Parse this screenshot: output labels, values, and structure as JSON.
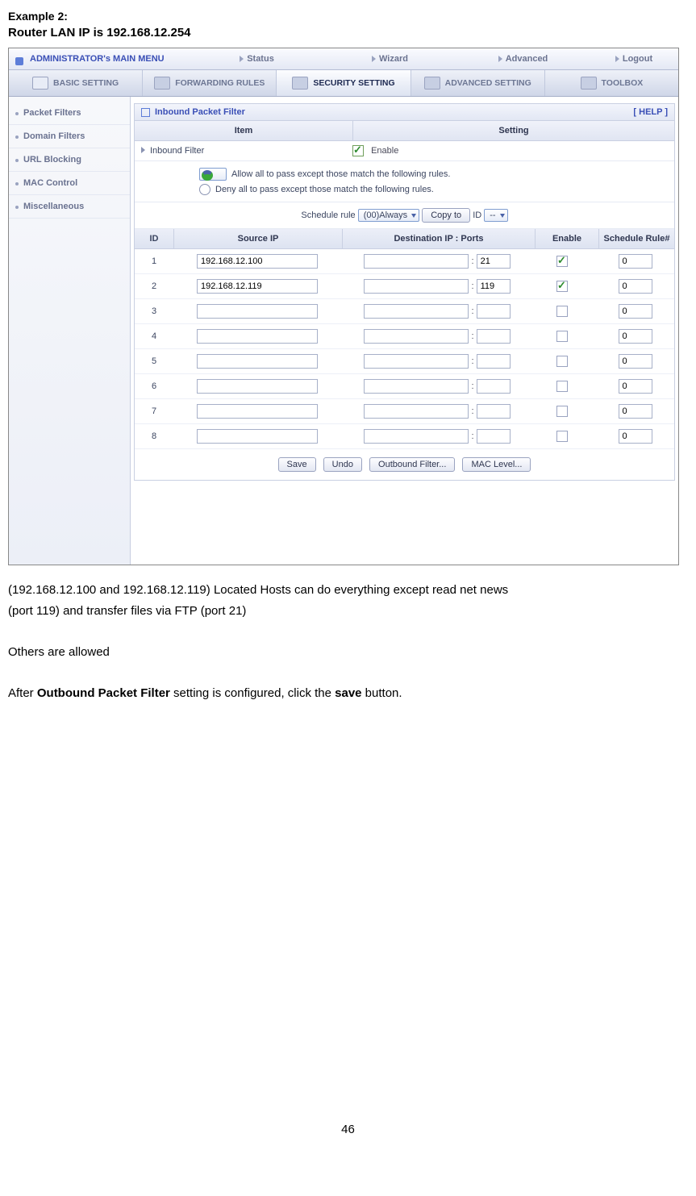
{
  "doc": {
    "example_label": "Example 2:",
    "router_line": "Router LAN IP is 192.168.12.254",
    "para1_a": "(192.168.12.100 and 192.168.12.119) Located Hosts can do everything except read net news",
    "para1_b": "(port 119) and transfer files via FTP (port 21)",
    "para2": "Others are allowed",
    "para3_a": "After ",
    "para3_bold": "Outbound Packet Filter",
    "para3_b": " setting is configured, click the ",
    "para3_bold2": "save",
    "para3_c": " button.",
    "pagenum": "46"
  },
  "topbar": {
    "title": "ADMINISTRATOR's MAIN MENU",
    "items": [
      "Status",
      "Wizard",
      "Advanced"
    ],
    "logout": "Logout"
  },
  "tabs": [
    "BASIC SETTING",
    "FORWARDING RULES",
    "SECURITY SETTING",
    "ADVANCED SETTING",
    "TOOLBOX"
  ],
  "tabs_active_index": 2,
  "sidebar": [
    "Packet Filters",
    "Domain Filters",
    "URL Blocking",
    "MAC Control",
    "Miscellaneous"
  ],
  "panel": {
    "title": "Inbound Packet Filter",
    "help": "[ HELP ]",
    "col_item": "Item",
    "col_setting": "Setting",
    "inbound_label": "Inbound Filter",
    "enable_label": "Enable",
    "radio_allow": "Allow all to pass except those match the following rules.",
    "radio_deny": "Deny all to pass except those match the following rules.",
    "sched_label": "Schedule rule",
    "sched_sel": "(00)Always",
    "copy_btn": "Copy to",
    "id_label": "ID",
    "id_sel": "--"
  },
  "grid": {
    "headers": {
      "id": "ID",
      "src": "Source IP",
      "dst": "Destination IP : Ports",
      "en": "Enable",
      "sch": "Schedule Rule#"
    },
    "rows": [
      {
        "id": "1",
        "src": "192.168.12.100",
        "dst_ip": "",
        "dst_port": "21",
        "en": true,
        "sch": "0"
      },
      {
        "id": "2",
        "src": "192.168.12.119",
        "dst_ip": "",
        "dst_port": "119",
        "en": true,
        "sch": "0"
      },
      {
        "id": "3",
        "src": "",
        "dst_ip": "",
        "dst_port": "",
        "en": false,
        "sch": "0"
      },
      {
        "id": "4",
        "src": "",
        "dst_ip": "",
        "dst_port": "",
        "en": false,
        "sch": "0"
      },
      {
        "id": "5",
        "src": "",
        "dst_ip": "",
        "dst_port": "",
        "en": false,
        "sch": "0"
      },
      {
        "id": "6",
        "src": "",
        "dst_ip": "",
        "dst_port": "",
        "en": false,
        "sch": "0"
      },
      {
        "id": "7",
        "src": "",
        "dst_ip": "",
        "dst_port": "",
        "en": false,
        "sch": "0"
      },
      {
        "id": "8",
        "src": "",
        "dst_ip": "",
        "dst_port": "",
        "en": false,
        "sch": "0"
      }
    ]
  },
  "buttons": {
    "save": "Save",
    "undo": "Undo",
    "outbound": "Outbound Filter...",
    "mac": "MAC Level..."
  }
}
